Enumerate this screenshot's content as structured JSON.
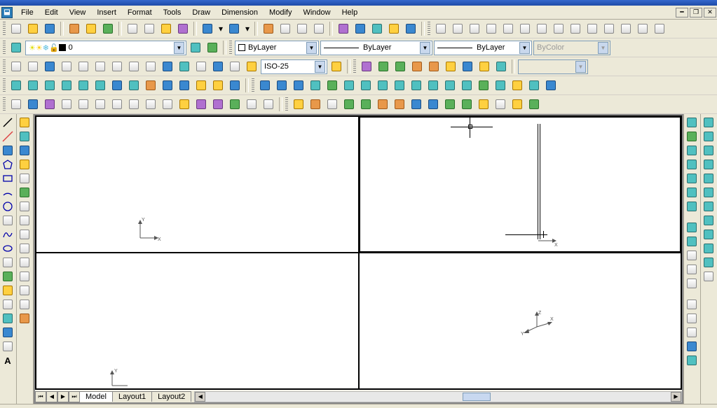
{
  "menu": {
    "items": [
      "File",
      "Edit",
      "View",
      "Insert",
      "Format",
      "Tools",
      "Draw",
      "Dimension",
      "Modify",
      "Window",
      "Help"
    ]
  },
  "layer_dropdown": {
    "value": "0"
  },
  "color_dropdown": {
    "value": "ByLayer"
  },
  "linetype_dropdown": {
    "value": "ByLayer"
  },
  "lineweight_dropdown": {
    "value": "ByLayer"
  },
  "plotstyle_dropdown": {
    "value": "ByColor"
  },
  "dimstyle_dropdown": {
    "value": "ISO-25"
  },
  "tabs": {
    "items": [
      "Model",
      "Layout1",
      "Layout2"
    ],
    "active": 0
  },
  "axis_labels": {
    "x": "X",
    "y": "Y",
    "z": "Z"
  },
  "nav_glyphs": {
    "first": "⏮",
    "prev": "◀",
    "next": "▶",
    "last": "⏭",
    "left": "◀",
    "right": "▶"
  },
  "win_glyphs": {
    "min": "━",
    "restore": "❐",
    "close": "✕"
  }
}
